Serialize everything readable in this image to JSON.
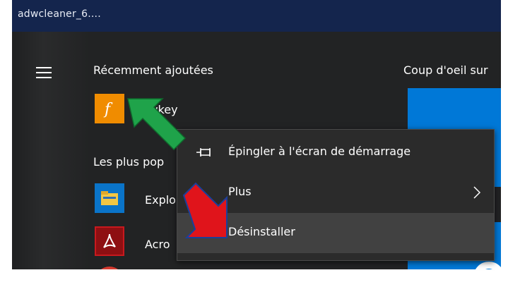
{
  "window": {
    "title": "adwcleaner_6...."
  },
  "start_menu": {
    "recent_header": "Récemment ajoutées",
    "recent_item_label": "Flowkey",
    "popular_header": "Les plus pop",
    "glance_header": "Coup d'oeil sur",
    "apps": [
      {
        "label": "Explo",
        "icon": "file-explorer-icon"
      },
      {
        "label": "Acro",
        "icon": "acrobat-icon"
      }
    ]
  },
  "context_menu": {
    "items": [
      {
        "label": "Épingler à l'écran de démarrage",
        "icon": "pin-icon"
      },
      {
        "label": "Plus",
        "icon": "chevron-right-icon"
      },
      {
        "label": "Désinstaller"
      }
    ]
  },
  "colors": {
    "menu_bg": "#222324",
    "title_bar": "#14254d",
    "accent_tile": "#0078d7",
    "flowkey_tile": "#f08c00",
    "arrow_green": "#1fa34a",
    "arrow_red": "#e0141b"
  }
}
